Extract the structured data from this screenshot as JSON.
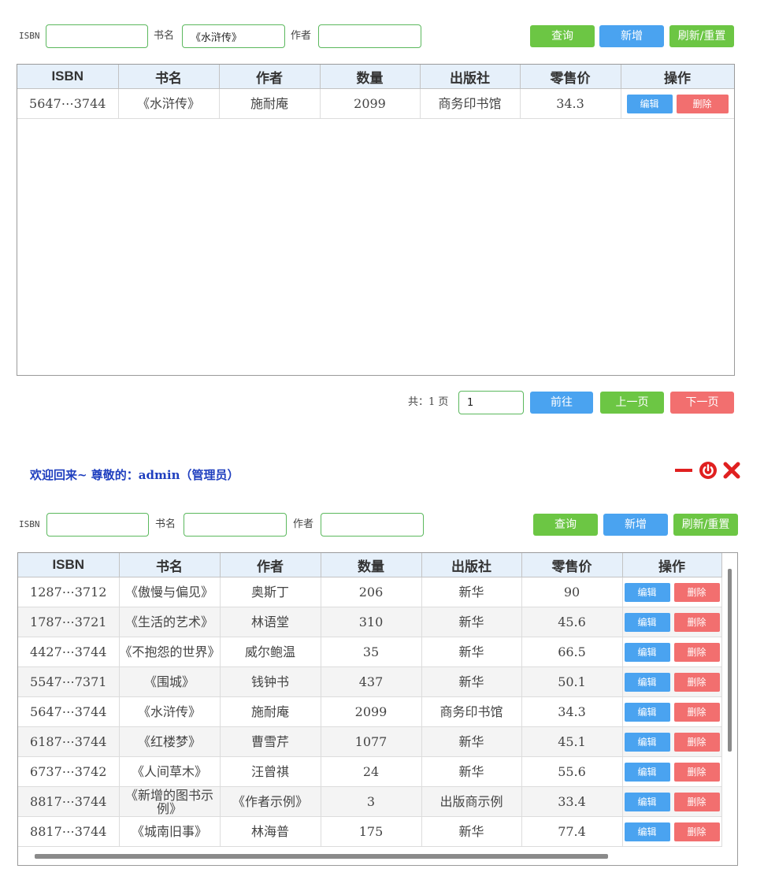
{
  "top": {
    "search": {
      "isbn_label": "ISBN",
      "isbn_value": "",
      "title_label": "书名",
      "title_value": "《水浒传》",
      "author_label": "作者",
      "author_value": ""
    },
    "buttons": {
      "query": "查询",
      "add": "新增",
      "refresh": "刷新/重置"
    },
    "table": {
      "headers": [
        "ISBN",
        "书名",
        "作者",
        "数量",
        "出版社",
        "零售价",
        "操作"
      ],
      "rows": [
        {
          "isbn": "5647⋯3744",
          "title": "《水浒传》",
          "author": "施耐庵",
          "qty": "2099",
          "publisher": "商务印书馆",
          "price": "34.3",
          "edit": "编辑",
          "delete": "删除"
        }
      ]
    },
    "pagination": {
      "total_label": "共：1 页",
      "page_value": "1",
      "goto": "前往",
      "prev": "上一页",
      "next": "下一页"
    }
  },
  "welcome": {
    "text": "欢迎回来~ 尊敬的：admin（管理员）"
  },
  "window_controls": {
    "minimize_color": "#e02020",
    "power_color": "#e02020",
    "close_color": "#e02020"
  },
  "bottom": {
    "search": {
      "isbn_label": "ISBN",
      "isbn_value": "",
      "title_label": "书名",
      "title_value": "",
      "author_label": "作者",
      "author_value": ""
    },
    "buttons": {
      "query": "查询",
      "add": "新增",
      "refresh": "刷新/重置"
    },
    "table": {
      "headers": [
        "ISBN",
        "书名",
        "作者",
        "数量",
        "出版社",
        "零售价",
        "操作"
      ],
      "rows": [
        {
          "isbn": "1287⋯3712",
          "title": "《傲慢与偏见》",
          "author": "奥斯丁",
          "qty": "206",
          "publisher": "新华",
          "price": "90",
          "edit": "编辑",
          "delete": "删除"
        },
        {
          "isbn": "1787⋯3721",
          "title": "《生活的艺术》",
          "author": "林语堂",
          "qty": "310",
          "publisher": "新华",
          "price": "45.6",
          "edit": "编辑",
          "delete": "删除"
        },
        {
          "isbn": "4427⋯3744",
          "title": "《不抱怨的世界》",
          "author": "威尔鲍温",
          "qty": "35",
          "publisher": "新华",
          "price": "66.5",
          "edit": "编辑",
          "delete": "删除"
        },
        {
          "isbn": "5547⋯7371",
          "title": "《围城》",
          "author": "钱钟书",
          "qty": "437",
          "publisher": "新华",
          "price": "50.1",
          "edit": "编辑",
          "delete": "删除"
        },
        {
          "isbn": "5647⋯3744",
          "title": "《水浒传》",
          "author": "施耐庵",
          "qty": "2099",
          "publisher": "商务印书馆",
          "price": "34.3",
          "edit": "编辑",
          "delete": "删除"
        },
        {
          "isbn": "6187⋯3744",
          "title": "《红楼梦》",
          "author": "曹雪芹",
          "qty": "1077",
          "publisher": "新华",
          "price": "45.1",
          "edit": "编辑",
          "delete": "删除"
        },
        {
          "isbn": "6737⋯3742",
          "title": "《人间草木》",
          "author": "汪曾祺",
          "qty": "24",
          "publisher": "新华",
          "price": "55.6",
          "edit": "编辑",
          "delete": "删除"
        },
        {
          "isbn": "8817⋯3744",
          "title": "《新增的图书示例》",
          "author": "《作者示例》",
          "qty": "3",
          "publisher": "出版商示例",
          "price": "33.4",
          "edit": "编辑",
          "delete": "删除"
        },
        {
          "isbn": "8817⋯3744",
          "title": "《城南旧事》",
          "author": "林海普",
          "qty": "175",
          "publisher": "新华",
          "price": "77.4",
          "edit": "编辑",
          "delete": "删除"
        }
      ]
    }
  }
}
